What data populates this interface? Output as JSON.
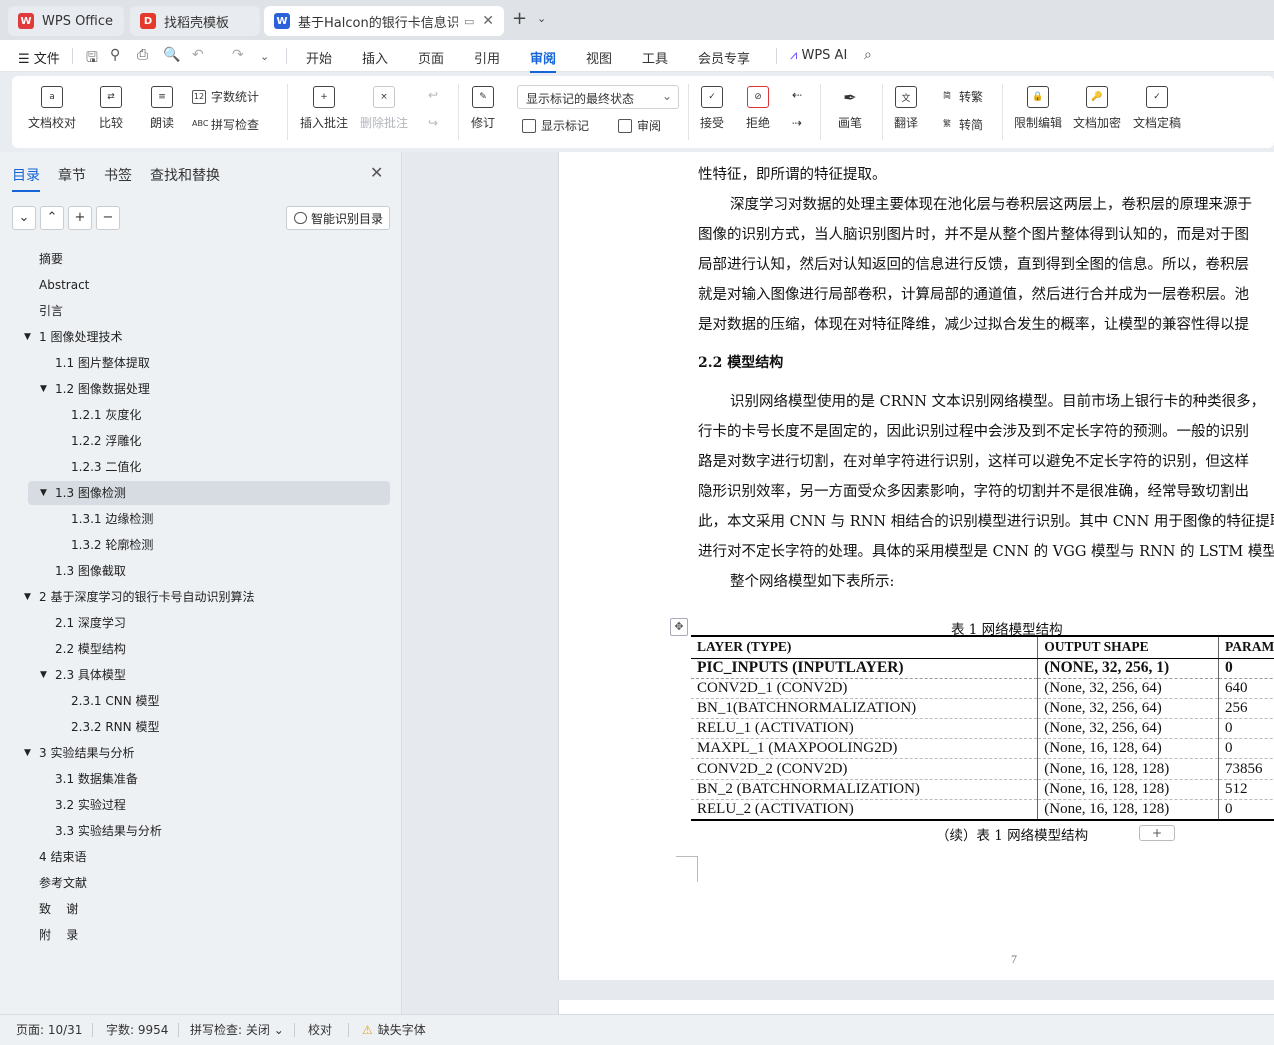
{
  "tabs": [
    {
      "label": "WPS Office",
      "icon": "wps-logo-icon",
      "color": "#e03a3a"
    },
    {
      "label": "找稻壳模板",
      "icon": "docer-logo-icon",
      "color": "#e4392b"
    },
    {
      "label": "基于Halcon的银行卡信息识别",
      "icon": "writer-logo-icon",
      "color": "#2b62d9",
      "active": true
    }
  ],
  "menubar": {
    "file_label": "文件",
    "items": [
      "开始",
      "插入",
      "页面",
      "引用",
      "审阅",
      "视图",
      "工具",
      "会员专享"
    ],
    "active": "审阅",
    "ai_label": "WPS AI"
  },
  "ribbon": {
    "proofread": "文档校对",
    "compare": "比较",
    "read_aloud": "朗读",
    "word_count": "字数统计",
    "spell_check": "拼写检查",
    "insert_comment": "插入批注",
    "delete_comment": "删除批注",
    "track_changes": "修订",
    "markup_state": "显示标记的最终状态",
    "show_markup": "显示标记",
    "review_pane": "审阅",
    "accept": "接受",
    "reject": "拒绝",
    "pen": "画笔",
    "translate": "翻译",
    "to_traditional": "转繁",
    "to_simplified": "转简",
    "restrict_edit": "限制编辑",
    "encrypt": "文档加密",
    "finalize": "文档定稿"
  },
  "nav": {
    "tabs": [
      "目录",
      "章节",
      "书签",
      "查找和替换"
    ],
    "smart_toc": "智能识别目录",
    "toc": [
      {
        "label": "摘要"
      },
      {
        "label": "Abstract"
      },
      {
        "label": "引言"
      },
      {
        "label": "1  图像处理技术"
      },
      {
        "label": "1.1 图片整体提取"
      },
      {
        "label": "1.2 图像数据处理"
      },
      {
        "label": "1.2.1 灰度化"
      },
      {
        "label": "1.2.2 浮雕化"
      },
      {
        "label": "1.2.3 二值化"
      },
      {
        "label": "1.3 图像检测"
      },
      {
        "label": "1.3.1 边缘检测"
      },
      {
        "label": "1.3.2 轮廓检测"
      },
      {
        "label": "1.3 图像截取"
      },
      {
        "label": "2  基于深度学习的银行卡号自动识别算法"
      },
      {
        "label": "2.1 深度学习"
      },
      {
        "label": "2.2 模型结构"
      },
      {
        "label": "2.3 具体模型"
      },
      {
        "label": "2.3.1 CNN 模型"
      },
      {
        "label": "2.3.2 RNN 模型"
      },
      {
        "label": "3  实验结果与分析"
      },
      {
        "label": "3.1 数据集准备"
      },
      {
        "label": "3.2 实验过程"
      },
      {
        "label": "3.3 实验结果与分析"
      },
      {
        "label": "4  结束语"
      },
      {
        "label": "参考文献"
      },
      {
        "label": "致    谢"
      },
      {
        "label": "附    录"
      }
    ]
  },
  "doc": {
    "lines": [
      "性特征，即所谓的特征提取。",
      "深度学习对数据的处理主要体现在池化层与卷积层这两层上，卷积层的原理来源于",
      "图像的识别方式，当人脑识别图片时，并不是从整个图片整体得到认知的，而是对于图",
      "局部进行认知，然后对认知返回的信息进行反馈，直到得到全图的信息。所以，卷积层",
      "就是对输入图像进行局部卷积，计算局部的通道值，然后进行合并成为一层卷积层。池",
      "是对数据的压缩，体现在对特征降维，减少过拟合发生的概率，让模型的兼容性得以提"
    ],
    "heading": "2.2 模型结构",
    "lines2": [
      "识别网络模型使用的是 CRNN 文本识别网络模型。目前市场上银行卡的种类很多，",
      "行卡的卡号长度不是固定的，因此识别过程中会涉及到不定长字符的预测。一般的识别",
      "路是对数字进行切割，在对单字符进行识别，这样可以避免不定长字符的识别，但这样",
      "隐形识别效率，另一方面受众多因素影响，字符的切割并不是很准确，经常导致切割出",
      "此，本文采用 CNN 与 RNN 相结合的识别模型进行识别。其中 CNN 用于图像的特征提取",
      "进行对不定长字符的处理。具体的采用模型是 CNN  的 VGG 模型与 RNN 的 LSTM 模型",
      "整个网络模型如下表所示:"
    ],
    "table_caption": "表  1  网络模型结构",
    "table_headers": [
      "LAYER (TYPE)",
      "OUTPUT SHAPE",
      "PARAM"
    ],
    "table_rows": [
      [
        "PIC_INPUTS (INPUTLAYER)",
        "(NONE, 32, 256, 1)",
        "0"
      ],
      [
        "CONV2D_1 (CONV2D)",
        "(None, 32, 256, 64)",
        "640"
      ],
      [
        "BN_1(BATCHNORMALIZATION)",
        "(None, 32, 256, 64)",
        "256"
      ],
      [
        "RELU_1 (ACTIVATION)",
        "(None, 32, 256, 64)",
        "0"
      ],
      [
        "MAXPL_1 (MAXPOOLING2D)",
        "(None, 16, 128, 64)",
        "0"
      ],
      [
        "CONV2D_2 (CONV2D)",
        "(None, 16, 128, 128)",
        "73856"
      ],
      [
        "BN_2 (BATCHNORMALIZATION)",
        "(None, 16, 128, 128)",
        "512"
      ],
      [
        "RELU_2 (ACTIVATION)",
        "(None, 16, 128, 128)",
        "0"
      ]
    ],
    "continued_caption": "（续）表  1  网络模型结构",
    "page_number": "7"
  },
  "status": {
    "page": "页面: 10/31",
    "words": "字数: 9954",
    "spell": "拼写检查: 关闭",
    "proof": "校对",
    "missing_font": "缺失字体"
  }
}
